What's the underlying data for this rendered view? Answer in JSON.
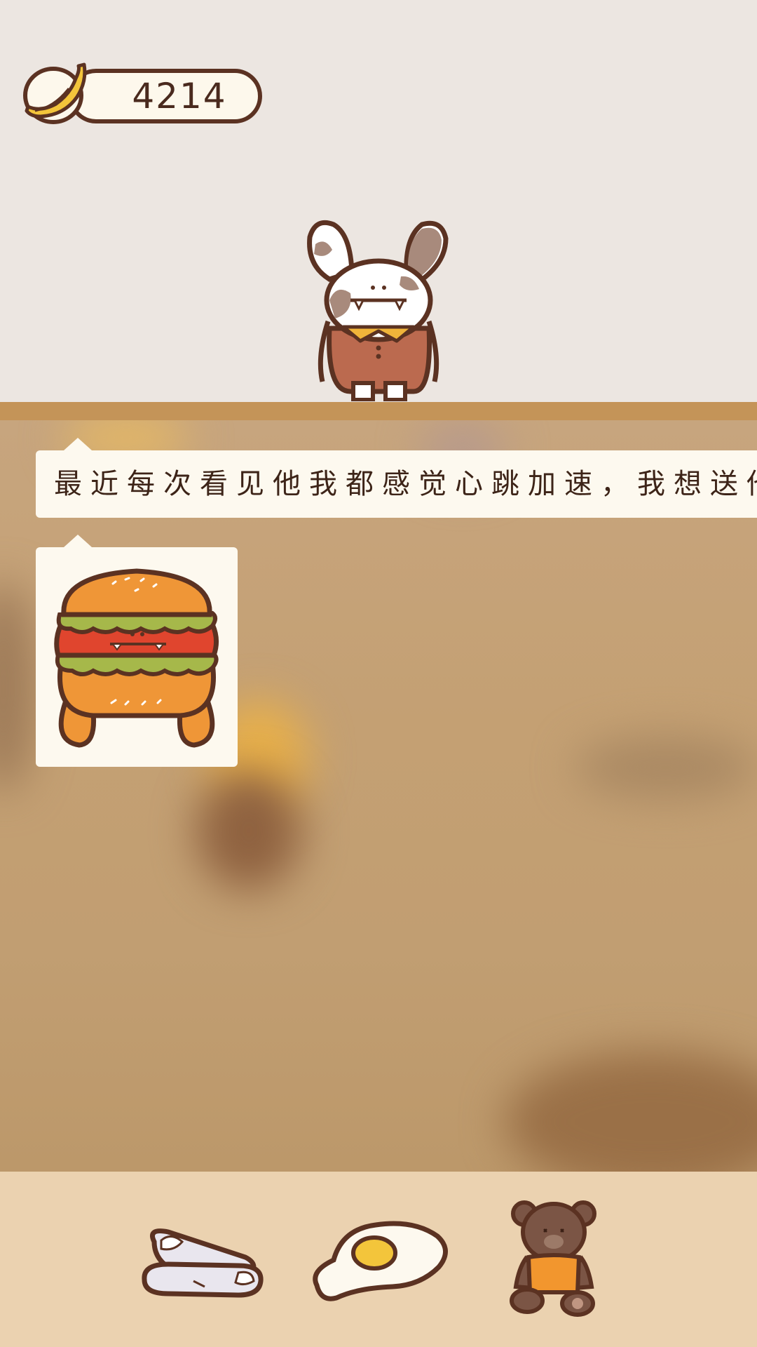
{
  "currency": {
    "icon": "banana-icon",
    "value": "4214"
  },
  "character": {
    "icon": "bunny-character-icon"
  },
  "dialogue": {
    "text": "最近每次看见他我都感觉心跳加速，我想送他",
    "image_icon": "burger-monster-icon"
  },
  "tray": {
    "items": [
      {
        "icon": "slippers-icon"
      },
      {
        "icon": "fried-egg-icon"
      },
      {
        "icon": "teddy-bear-icon"
      }
    ]
  },
  "colors": {
    "background_top": "#ece6e1",
    "shelf": "#c49458",
    "tray": "#ebd2b0",
    "bubble": "#fdf9ef",
    "outline": "#5b3222"
  }
}
